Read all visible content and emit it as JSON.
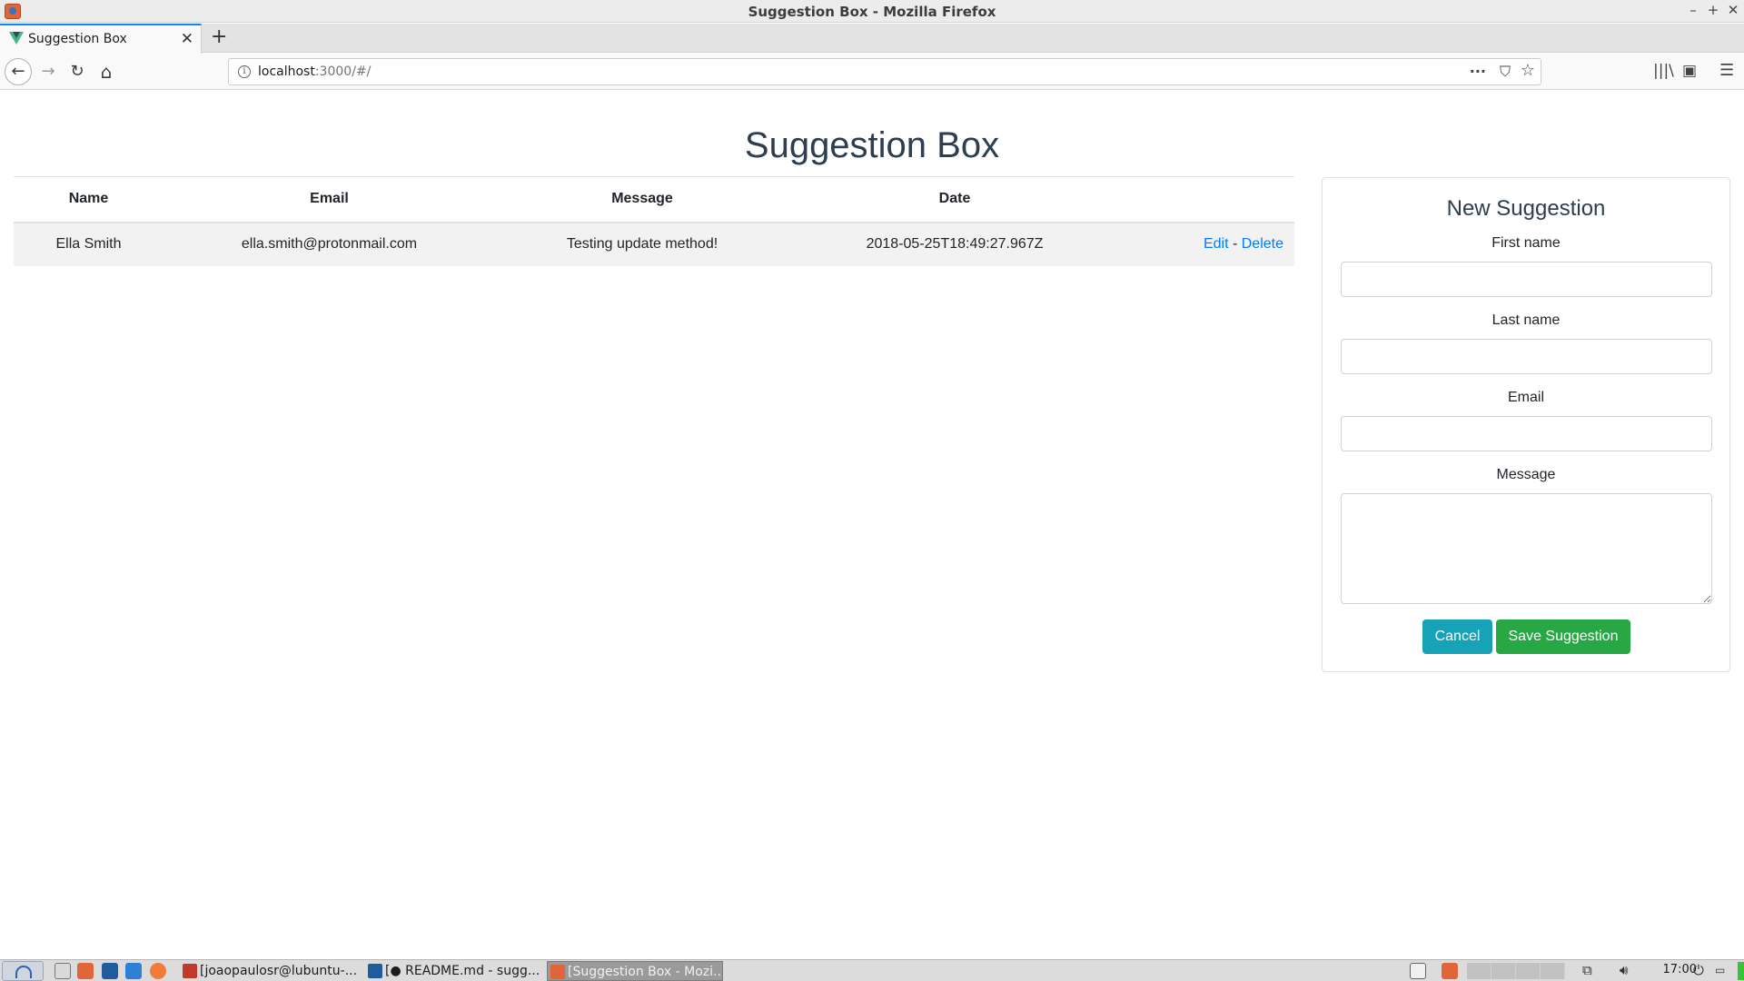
{
  "window": {
    "title": "Suggestion Box - Mozilla Firefox",
    "min": "–",
    "max": "+",
    "close": "✕"
  },
  "tab": {
    "title": "Suggestion Box",
    "close": "✕",
    "new_tab": "+"
  },
  "nav": {
    "back": "←",
    "forward": "→",
    "reload": "↻",
    "home": "⌂",
    "url_host": "localhost",
    "url_rest": ":3000/#/",
    "info": "i",
    "more": "···",
    "pocket": "⛉",
    "bookmark": "☆",
    "library": "|||\\",
    "sidebar": "▣",
    "menu": "☰"
  },
  "page": {
    "title": "Suggestion Box",
    "table": {
      "headers": [
        "Name",
        "Email",
        "Message",
        "Date",
        ""
      ],
      "rows": [
        {
          "name": "Ella Smith",
          "email": "ella.smith@protonmail.com",
          "message": "Testing update method!",
          "date": "2018-05-25T18:49:27.967Z",
          "edit": "Edit",
          "sep": " - ",
          "delete": "Delete"
        }
      ]
    },
    "form": {
      "title": "New Suggestion",
      "first_name_label": "First name",
      "last_name_label": "Last name",
      "email_label": "Email",
      "message_label": "Message",
      "first_name_value": "",
      "last_name_value": "",
      "email_value": "",
      "message_value": "",
      "cancel_label": "Cancel",
      "save_label": "Save Suggestion"
    }
  },
  "taskbar": {
    "tasks": [
      {
        "label": "[joaopaulosr@lubuntu-...",
        "icon_color": "#c0392b"
      },
      {
        "label": "[● README.md - sugg...",
        "icon_color": "#1f5c9e"
      },
      {
        "label": "[Suggestion Box - Mozi...",
        "icon_color": "#e0663a"
      }
    ],
    "clock": "17:00"
  },
  "colors": {
    "accent_blue": "#007bff",
    "cancel_teal": "#17a2b8",
    "save_green": "#28a745",
    "heading": "#2c3e50"
  }
}
